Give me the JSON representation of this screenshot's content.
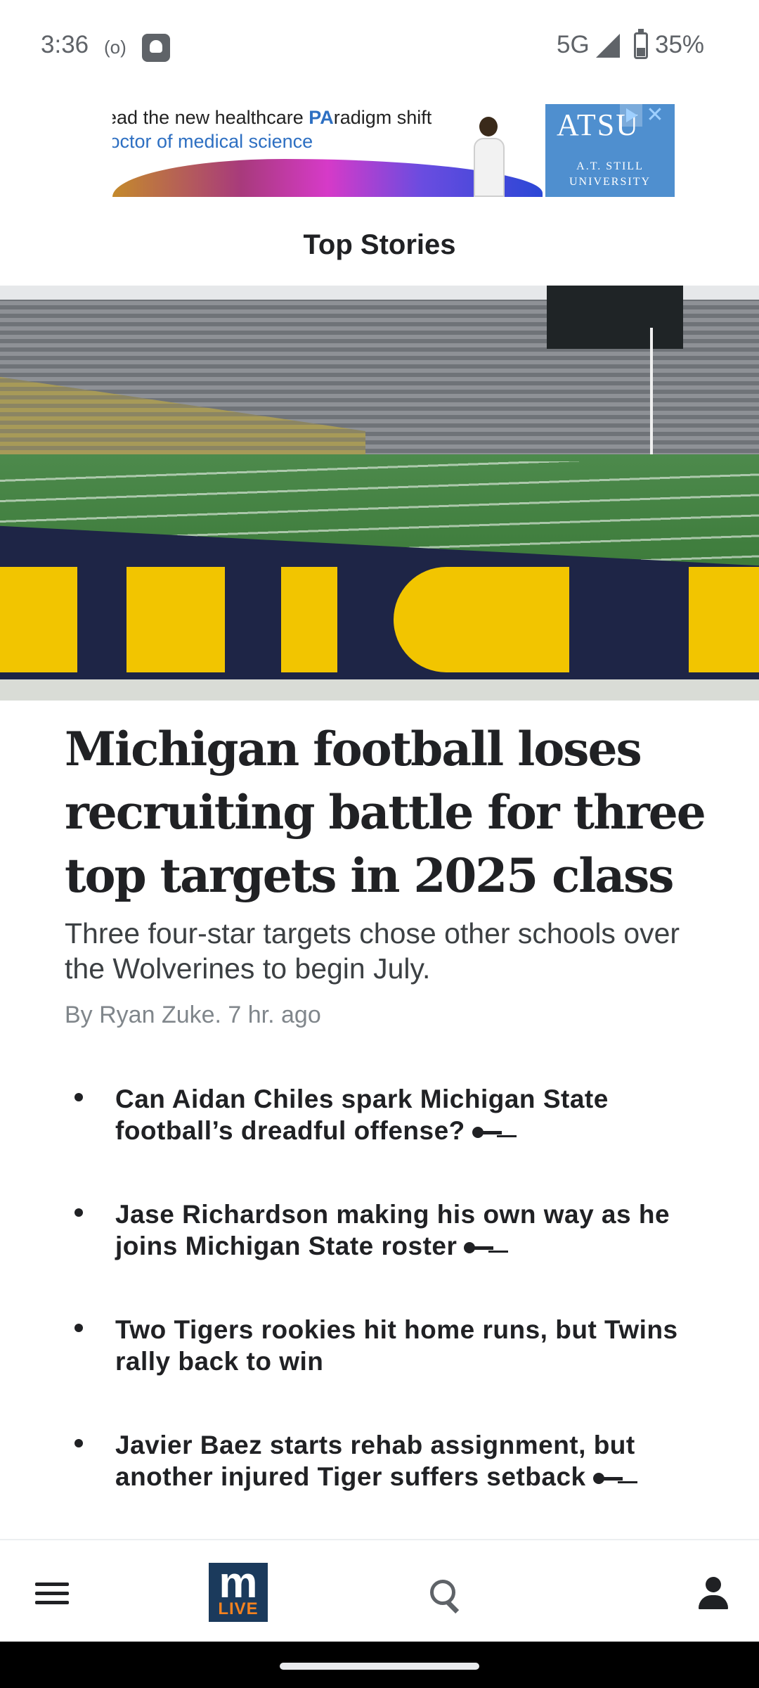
{
  "status_bar": {
    "time": "3:36",
    "radio_indicator": "(o)",
    "network": "5G",
    "battery_percent": "35%",
    "icons": [
      "app-notification-icon",
      "signal-icon",
      "battery-icon"
    ]
  },
  "ad": {
    "line1_prefix": "Lead the new healthcare ",
    "line1_highlight": "PA",
    "line1_suffix": "radigm shift",
    "line2": "Doctor of medical science",
    "logo_main": "ATSU",
    "logo_sub1": "A.T. STILL",
    "logo_sub2": "UNIVERSITY",
    "close_glyph": "✕",
    "accent_color": "#2d6fc2"
  },
  "section": {
    "title": "Top Stories"
  },
  "lead_story": {
    "headline": "Michigan football loses recruiting battle for three top targets in 2025 class",
    "dek": "Three four-star targets chose other schools over the Wolverines to begin July.",
    "byline": "By Ryan Zuke. 7 hr. ago"
  },
  "related_stories": [
    {
      "title": "Can Aidan Chiles spark Michigan State football’s dreadful offense?",
      "premium": true
    },
    {
      "title": "Jase Richardson making his own way as he joins Michigan State roster",
      "premium": true
    },
    {
      "title": "Two Tigers rookies hit home runs, but Twins rally back to win",
      "premium": false
    },
    {
      "title": "Javier Baez starts rehab assignment, but another injured Tiger suffers setback",
      "premium": true
    }
  ],
  "bottom_nav": {
    "brand_m": "m",
    "brand_live": "LIVE",
    "brand_color": "#1b3a5c",
    "brand_accent": "#f5821f",
    "icons": [
      "menu-icon",
      "search-icon",
      "account-icon"
    ]
  }
}
